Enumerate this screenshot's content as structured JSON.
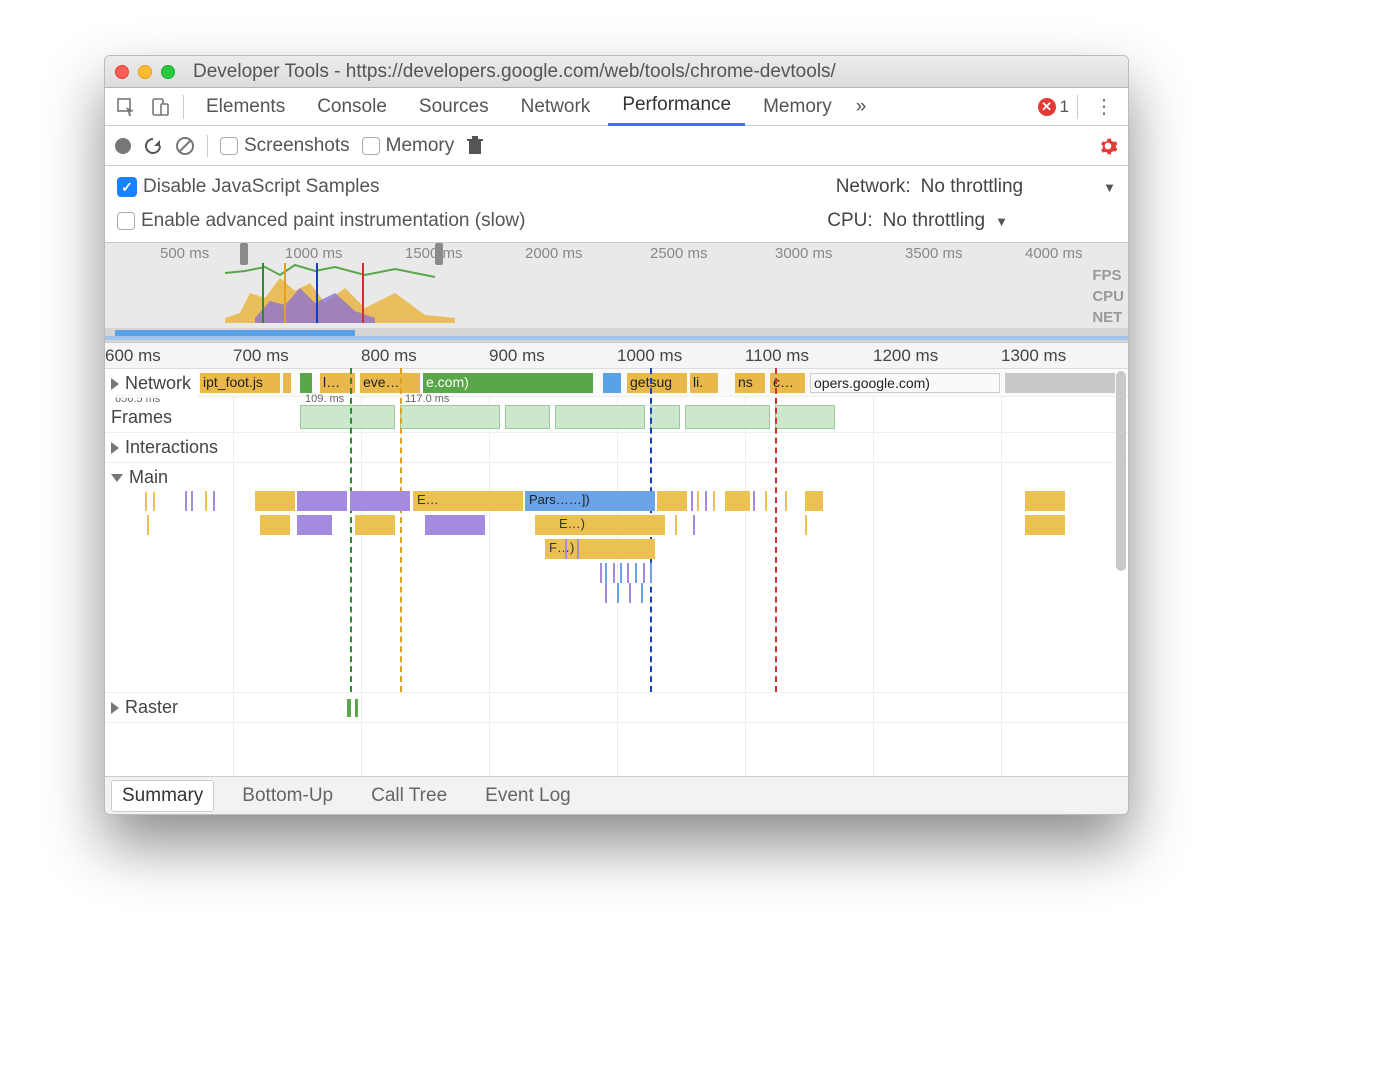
{
  "window": {
    "title": "Developer Tools - https://developers.google.com/web/tools/chrome-devtools/"
  },
  "tabs": {
    "items": [
      "Elements",
      "Console",
      "Sources",
      "Network",
      "Performance",
      "Memory"
    ],
    "active": "Performance",
    "overflow_glyph": "»",
    "error_count": "1"
  },
  "toolbar": {
    "screenshots_label": "Screenshots",
    "memory_label": "Memory"
  },
  "settings": {
    "disable_js_label": "Disable JavaScript Samples",
    "disable_js_checked": true,
    "enable_paint_label": "Enable advanced paint instrumentation (slow)",
    "network_label": "Network:",
    "network_value": "No throttling",
    "cpu_label": "CPU:",
    "cpu_value": "No throttling"
  },
  "overview": {
    "ticks": [
      "500 ms",
      "1000 ms",
      "1500 ms",
      "2000 ms",
      "2500 ms",
      "3000 ms",
      "3500 ms",
      "4000 ms"
    ],
    "right_labels": [
      "FPS",
      "CPU",
      "NET"
    ]
  },
  "ruler": {
    "ticks": [
      "600 ms",
      "700 ms",
      "800 ms",
      "900 ms",
      "1000 ms",
      "1100 ms",
      "1200 ms",
      "1300 ms"
    ]
  },
  "sections": {
    "network": "Network",
    "frames": "Frames",
    "interactions": "Interactions",
    "main": "Main",
    "raster": "Raster"
  },
  "network_segments": {
    "a": "ipt_foot.js",
    "b": "l…",
    "c": "eve…",
    "d": "e.com)",
    "e": "getsug",
    "f": "li.",
    "g": "ns",
    "h": "c…",
    "i": "opers.google.com)"
  },
  "frames": {
    "t0": "656.5 ms",
    "f1": "109. ms",
    "f2": "117.0 ms"
  },
  "flames": {
    "e": "E…",
    "parse": "Pars……])",
    "e2": "E…)",
    "f": "F…)"
  },
  "bottom_tabs": {
    "items": [
      "Summary",
      "Bottom-Up",
      "Call Tree",
      "Event Log"
    ],
    "active": "Summary"
  }
}
